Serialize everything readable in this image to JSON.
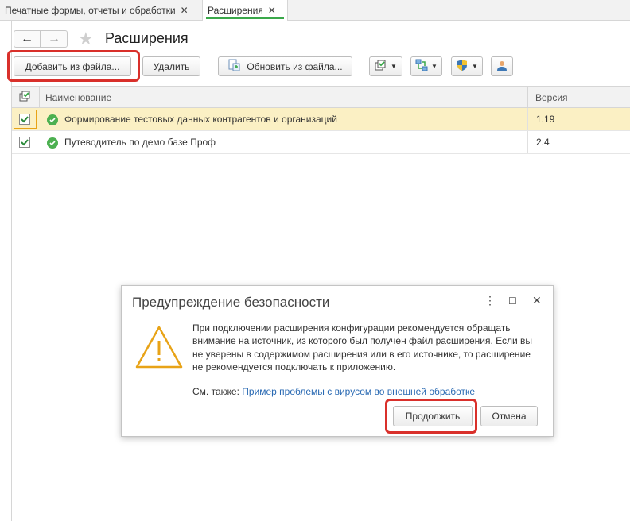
{
  "tabs": [
    {
      "label": "Печатные формы, отчеты и обработки",
      "close": "✕"
    },
    {
      "label": "Расширения",
      "close": "✕"
    }
  ],
  "page": {
    "title": "Расширения",
    "back_icon": "←",
    "forward_icon": "→"
  },
  "toolbar": {
    "add_label": "Добавить из файла...",
    "delete_label": "Удалить",
    "update_label": "Обновить из файла...",
    "icons": [
      "config-icon",
      "sync-icon",
      "shield-icon",
      "user-icon"
    ]
  },
  "table": {
    "columns": [
      "Наименование",
      "Версия"
    ],
    "rows": [
      {
        "checked": true,
        "status": "ok",
        "name": "Формирование тестовых данных контрагентов и организаций",
        "version": "1.19",
        "selected": true
      },
      {
        "checked": true,
        "status": "ok",
        "name": "Путеводитель по демо базе Проф",
        "version": "2.4",
        "selected": false
      }
    ]
  },
  "dialog": {
    "title": "Предупреждение безопасности",
    "text": "При подключении расширения конфигурации рекомендуется обращать внимание на источник, из которого был получен файл расширения. Если вы не уверены в содержимом расширения или в его источнике, то расширение не рекомендуется подключать к приложению.",
    "see_also_label": "См. также:",
    "link_text": "Пример проблемы с вирусом во внешней обработке",
    "continue_label": "Продолжить",
    "cancel_label": "Отмена",
    "menu_icon": "⋮",
    "maximize_icon": "☐",
    "close_icon": "✕"
  },
  "colors": {
    "highlight": "#d9302b",
    "selected_row": "#fbf0c4",
    "status_ok": "#4cb050",
    "warning": "#e8a317",
    "link": "#2a6ab3"
  }
}
